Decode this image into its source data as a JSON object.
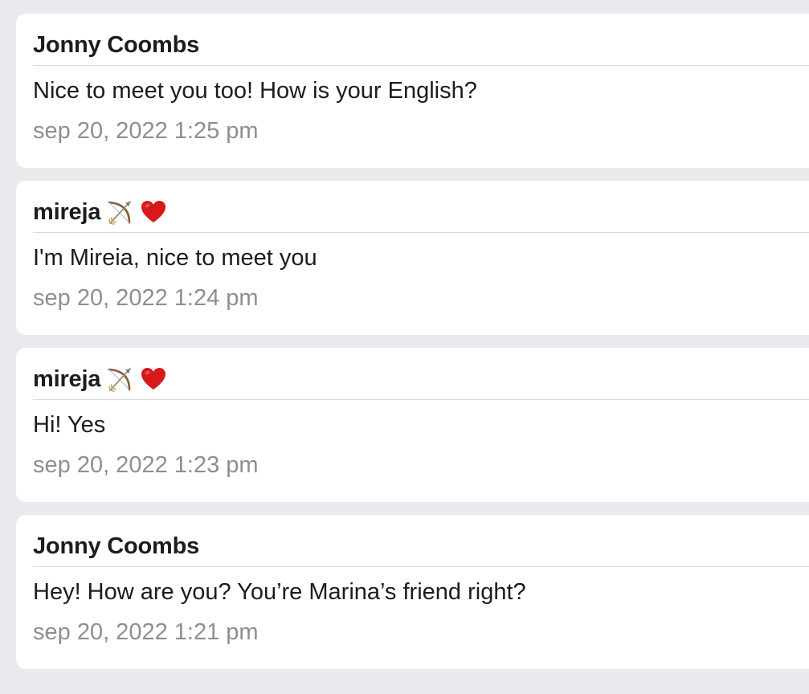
{
  "messages": [
    {
      "sender": "Jonny Coombs",
      "sender_emojis": [],
      "text": "Nice to meet you too! How is your English?",
      "timestamp": "sep 20, 2022 1:25 pm"
    },
    {
      "sender": "mireja",
      "sender_emojis": [
        "bow-and-arrow-icon",
        "red-heart-icon"
      ],
      "text": "I'm Mireia, nice to meet you",
      "timestamp": "sep 20, 2022 1:24 pm"
    },
    {
      "sender": "mireja",
      "sender_emojis": [
        "bow-and-arrow-icon",
        "red-heart-icon"
      ],
      "text": "Hi! Yes",
      "timestamp": "sep 20, 2022 1:23 pm"
    },
    {
      "sender": "Jonny Coombs",
      "sender_emojis": [],
      "text": "Hey! How are you? You’re Marina’s friend right?",
      "timestamp": "sep 20, 2022 1:21 pm"
    }
  ],
  "colors": {
    "background": "#e9eaee",
    "card": "#ffffff",
    "sender_text": "#1c1c1e",
    "timestamp_text": "#8e8e93",
    "heart": "#d7191c"
  }
}
